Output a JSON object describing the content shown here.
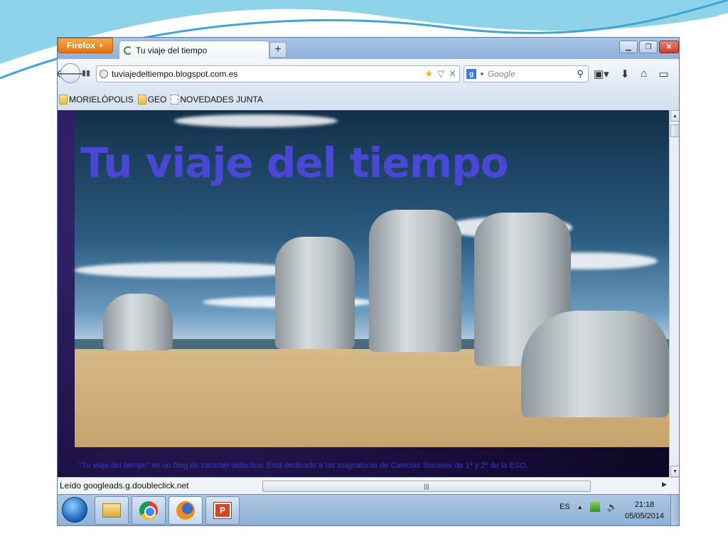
{
  "browser": {
    "menu_button": "Firefox",
    "tab_title": "Tu viaje del tiempo",
    "new_tab": "+",
    "url": "tuviajedeltiempo.blogspot.com.es",
    "search_placeholder": "Google",
    "search_engine_icon": "google-icon",
    "bookmarks": [
      "MORIELÓPOLIS",
      "GEO",
      "NOVEDADES JUNTA"
    ],
    "status_text": "Leído googleads.g.doubleclick.net"
  },
  "page": {
    "blog_title": "Tu viaje del tiempo",
    "description": "\"Tu viaje del tiempo\" es un blog de carácter didáctico. Está dedicado a las asignaturas de Ciencias Sociales de 1º y 2º de la ESO."
  },
  "taskbar": {
    "language": "ES",
    "time": "21:18",
    "date": "05/05/2014",
    "apps": [
      "windows-explorer",
      "google-chrome",
      "mozilla-firefox",
      "microsoft-powerpoint"
    ]
  },
  "colors": {
    "title_color": "#4a47d6",
    "firefox_button": "#e2740f",
    "slide_accent": "#4fb2d6"
  }
}
